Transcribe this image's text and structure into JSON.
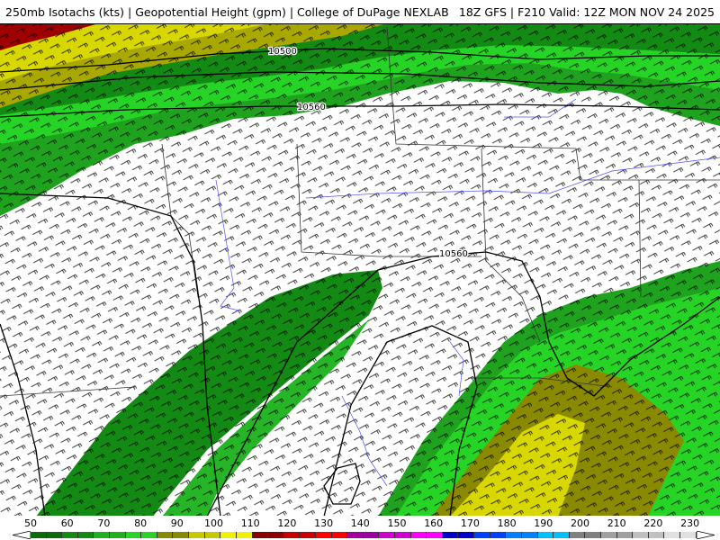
{
  "title": {
    "left": "250mb Isotachs (kts) | Geopotential Height (gpm) | College of DuPage NEXLAB",
    "right": "18Z GFS | F210 Valid: 12Z MON NOV 24 2025"
  },
  "contour_labels": [
    "10500",
    "10560",
    "10560"
  ],
  "legend": {
    "labels": [
      "50",
      "60",
      "70",
      "80",
      "90",
      "100",
      "110",
      "120",
      "130",
      "140",
      "150",
      "160",
      "170",
      "180",
      "190",
      "200",
      "210",
      "220",
      "230"
    ],
    "colors": [
      "#0a6b0a",
      "#138a13",
      "#1fb01f",
      "#26d426",
      "#8a8a00",
      "#c8c800",
      "#f0f000",
      "#8b0000",
      "#c80000",
      "#ff0000",
      "#a000a0",
      "#d000d0",
      "#ff00ff",
      "#0000c8",
      "#0040ff",
      "#0080ff",
      "#00c0ff",
      "#808080",
      "#a0a0a0",
      "#c0c0c0",
      "#e0e0e0"
    ]
  },
  "colors": {
    "dark_green": "#0a6b0a",
    "green": "#1fa31f",
    "light_green": "#26d426",
    "olive": "#8a8a00",
    "yellow": "#d8d800",
    "dark_red": "#a00000",
    "water": "#5050ff"
  }
}
